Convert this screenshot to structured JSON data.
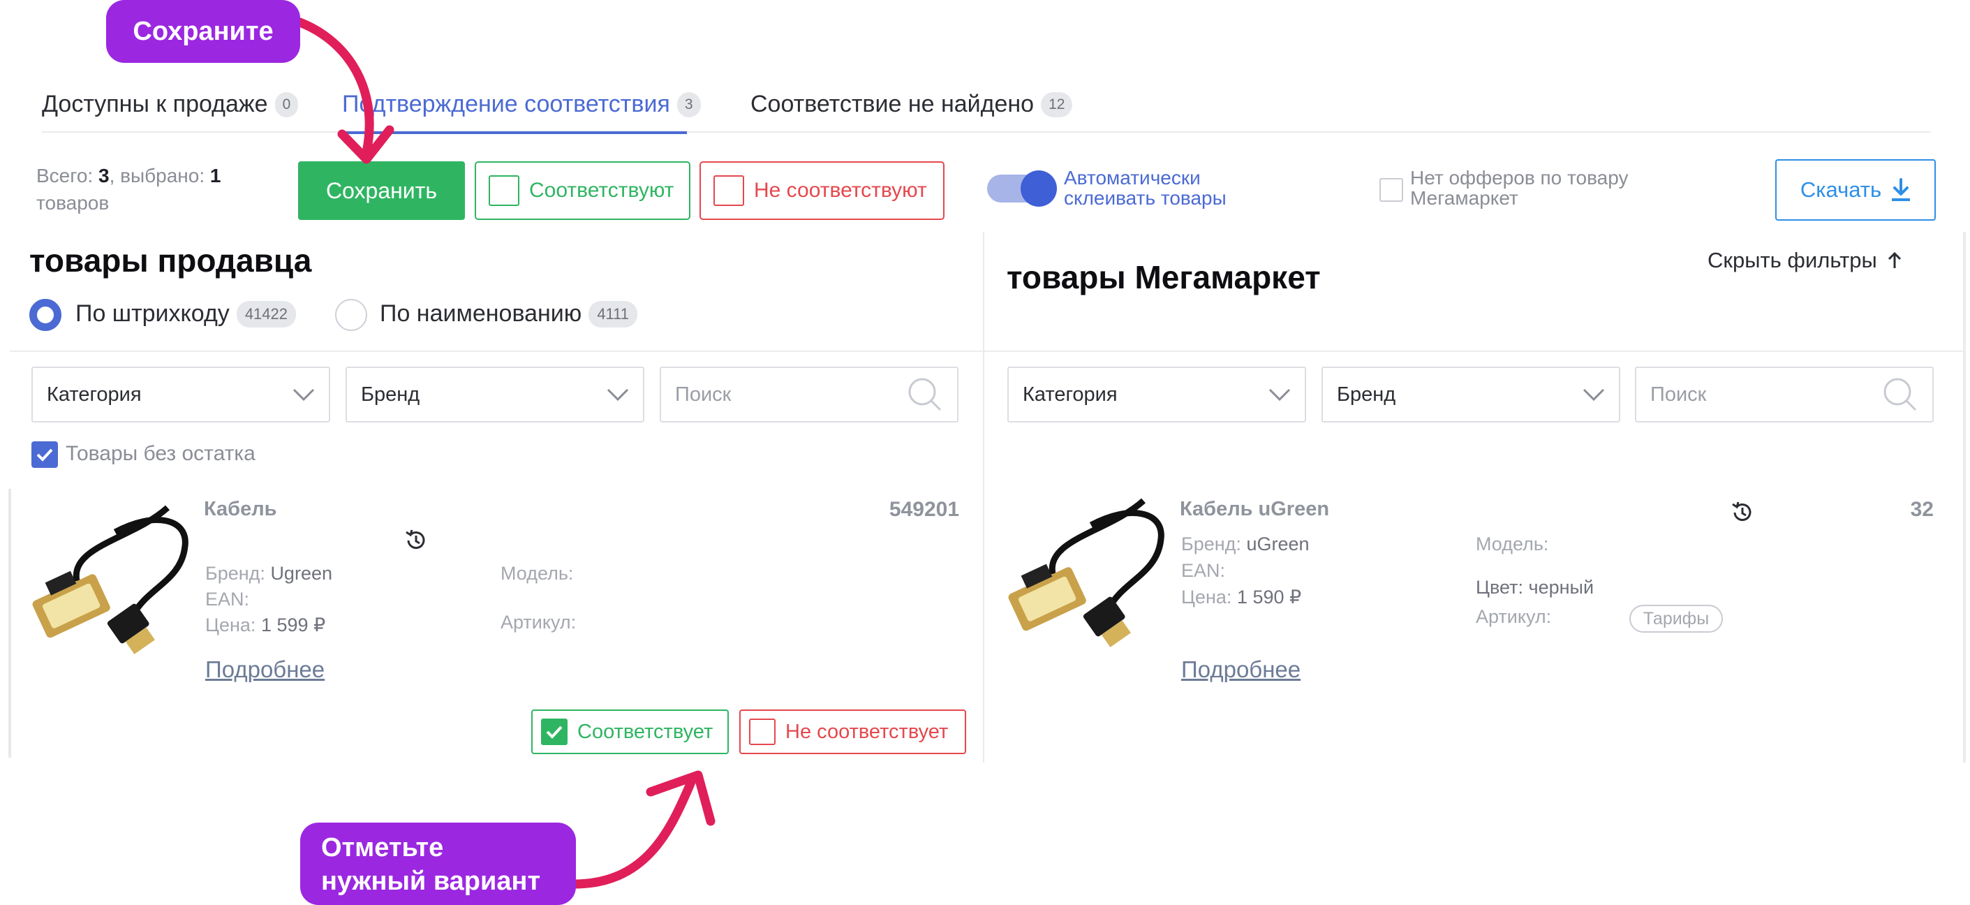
{
  "tabs": [
    {
      "label": "Доступны к продаже",
      "count": "0"
    },
    {
      "label": "Подтверждение соответствия",
      "count": "3"
    },
    {
      "label": "Соответствие не найдено",
      "count": "12"
    }
  ],
  "toolbar": {
    "total_prefix": "Всего: ",
    "total_count": "3",
    "selected_prefix": ", выбрано: ",
    "selected_count": "1",
    "total_suffix": "товаров",
    "save_label": "Сохранить",
    "match_label": "Соответствуют",
    "nomatch_label": "Не соответствуют",
    "auto_merge_label": "Автоматически склеивать товары",
    "auto_merge_on": true,
    "no_offers_label": "Нет офферов по товару Мегамаркет",
    "download_label": "Скачать"
  },
  "seller": {
    "title": "товары продавца",
    "radio_barcode": {
      "label": "По штрихкоду",
      "count": "41422"
    },
    "radio_name": {
      "label": "По наименованию",
      "count": "4111"
    },
    "filters": {
      "category": "Категория",
      "brand": "Бренд",
      "search_placeholder": "Поиск"
    },
    "no_stock_label": "Товары без остатка",
    "product": {
      "name": "Кабель",
      "number": "549201",
      "brand_label": "Бренд:",
      "brand_value": "Ugreen",
      "ean_label": "EAN:",
      "price_label": "Цена:",
      "price_value": "1 599 ₽",
      "model_label": "Модель:",
      "article_label": "Артикул:",
      "more_label": "Подробнее"
    },
    "match_label": "Соответствует",
    "nomatch_label": "Не соответствует"
  },
  "megamarket": {
    "title": "товары Мегамаркет",
    "hide_filters_label": "Скрыть фильтры",
    "filters": {
      "category": "Категория",
      "brand": "Бренд",
      "search_placeholder": "Поиск"
    },
    "product": {
      "name": "Кабель uGreen",
      "number": "32",
      "brand_label": "Бренд:",
      "brand_value": "uGreen",
      "ean_label": "EAN:",
      "price_label": "Цена:",
      "price_value": "1 590 ₽",
      "model_label": "Модель:",
      "color_label": "Цвет:",
      "color_value": "черный",
      "article_label": "Артикул:",
      "tariff_label": "Тарифы",
      "more_label": "Подробнее"
    }
  },
  "callouts": {
    "save": "Сохраните",
    "mark_line1": "Отметьте",
    "mark_line2": "нужный вариант"
  },
  "colors": {
    "accent": "#4b6ad3",
    "green": "#2fb562",
    "red": "#e5484d",
    "callout": "#9b28e0",
    "arrow": "#e01f5a"
  }
}
